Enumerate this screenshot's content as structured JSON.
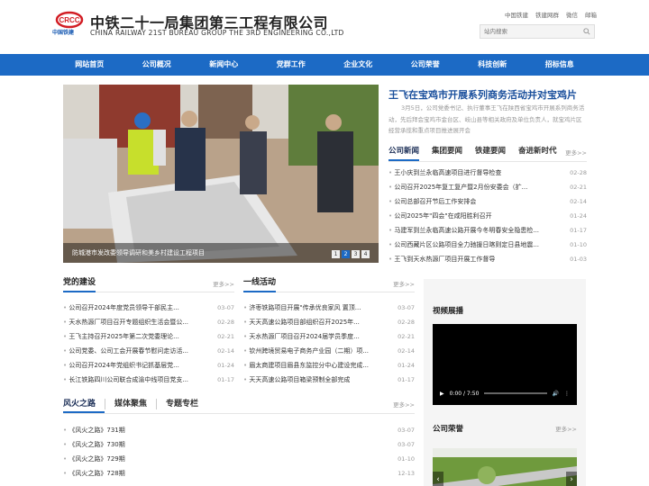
{
  "header": {
    "logo_text": "CRCC",
    "logo_sub": "中国铁建",
    "company_cn": "中铁二十一局集团第三工程有限公司",
    "company_en": "CHINA RAILWAY 21ST BUREAU GROUP THE 3RD ENGINEERING CO.,LTD",
    "top_links": [
      "中国铁建",
      "铁建网群",
      "微信",
      "邮箱"
    ],
    "search_placeholder": "站内搜索"
  },
  "nav": [
    "网站首页",
    "公司概况",
    "新闻中心",
    "党群工作",
    "企业文化",
    "公司荣誉",
    "科技创新",
    "招标信息"
  ],
  "slider": {
    "caption": "防城港市发改委领导调研和美乡村建设工程项目",
    "pages": [
      "1",
      "2",
      "3",
      "4"
    ],
    "active_page": 2
  },
  "headline": {
    "title": "王飞在宝鸡市开展系列商务活动并对宝鸡片",
    "summary": "3月5日，公司党委书记、执行董事王飞在陕西省宝鸡市开展系列商务活动，先后拜会宝鸡市金台区、岐山县等相关政府及单位负责人，就宝鸡片区经营承揽和重点项目推进展开会"
  },
  "news_tabs": [
    "公司新闻",
    "集团要闻",
    "铁建要闻",
    "奋进新时代"
  ],
  "more_label": "更多>>",
  "news": [
    {
      "title": "王小庆到兰永临高速项目进行督导检查",
      "date": "02-28"
    },
    {
      "title": "公司召开2025年复工复产暨2月份安委会（扩...",
      "date": "02-21"
    },
    {
      "title": "公司总部召开节后工作安排会",
      "date": "02-14"
    },
    {
      "title": "公司2025年\"四会\"在咸阳胜利召开",
      "date": "01-24"
    },
    {
      "title": "马建军到兰永临高速公路开展今冬明春安全隐患检...",
      "date": "01-17"
    },
    {
      "title": "公司西藏片区公路项目全力驰援日喀则定日县地震...",
      "date": "01-10"
    },
    {
      "title": "王飞到天水热源厂项目开展工作督导",
      "date": "01-03"
    }
  ],
  "party": {
    "title": "党的建设",
    "items": [
      {
        "title": "公司召开2024年度党员领导干部民主...",
        "date": "03-07"
      },
      {
        "title": "天水热源厂项目召开专题组织生活会暨公...",
        "date": "02-28"
      },
      {
        "title": "王飞主持召开2025年第二次党委理论...",
        "date": "02-21"
      },
      {
        "title": "公司党委、公司工会开展春节慰问走访活...",
        "date": "02-14"
      },
      {
        "title": "公司召开2024年党组织书记抓基层党...",
        "date": "01-24"
      },
      {
        "title": "长江铁路四川公司联合成渝中线项目党支...",
        "date": "01-17"
      }
    ]
  },
  "frontline": {
    "title": "一线活动",
    "items": [
      {
        "title": "济枣铁路项目开展\"传承优良家风 置顶...",
        "date": "03-07"
      },
      {
        "title": "天天高速公路项目部组织召开2025年...",
        "date": "02-28"
      },
      {
        "title": "天水热源厂项目召开2024届学员季度...",
        "date": "02-21"
      },
      {
        "title": "钦州跨境贸易电子商务产业园（二期）项...",
        "date": "02-14"
      },
      {
        "title": "眉太商建项目眉县东监控分中心建设完成...",
        "date": "01-24"
      },
      {
        "title": "天天高速公路项目箱梁预制全部完成",
        "date": "01-17"
      }
    ]
  },
  "bottom_tabs": [
    "风火之路",
    "媒体聚焦",
    "专题专栏"
  ],
  "fenghuo": [
    {
      "title": "《风火之路》731期",
      "date": "03-07"
    },
    {
      "title": "《风火之路》730期",
      "date": "03-07"
    },
    {
      "title": "《风火之路》729期",
      "date": "01-10"
    },
    {
      "title": "《风火之路》728期",
      "date": "12-13"
    }
  ],
  "right_panel": {
    "video_title": "视频展播",
    "video_time": "0:00 / 7:50",
    "honor_title": "公司荣誉"
  },
  "colors": {
    "nav_blue": "#1c6ac5",
    "headline_blue": "#1a4f9c"
  }
}
